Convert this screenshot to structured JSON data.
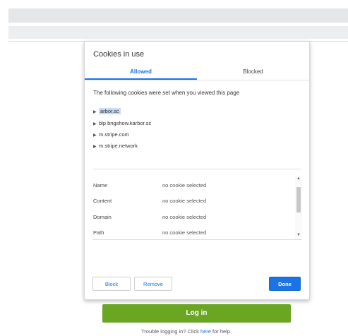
{
  "dialog": {
    "title": "Cookies in use",
    "tabs": [
      {
        "label": "Allowed"
      },
      {
        "label": "Blocked"
      }
    ],
    "description": "The following cookies were set when you viewed this page",
    "tree": [
      {
        "label": "arbor.sc"
      },
      {
        "label": "blp bngshow.karbor.sc"
      },
      {
        "label": "m.stripe.com"
      },
      {
        "label": "m.stripe.network"
      }
    ],
    "details": [
      {
        "label": "Name",
        "value": "no cookie selected"
      },
      {
        "label": "Content",
        "value": "no cookie selected"
      },
      {
        "label": "Domain",
        "value": "no cookie selected"
      },
      {
        "label": "Path",
        "value": "no cookie selected"
      }
    ],
    "buttons": {
      "block": "Block",
      "remove": "Remove",
      "done": "Done"
    }
  },
  "page": {
    "login_button": "Log in",
    "help_prefix": "Trouble logging in? Click ",
    "help_link": "here",
    "help_suffix": " for help"
  },
  "colors": {
    "accent": "#1a73e8",
    "login": "#6aa622"
  }
}
